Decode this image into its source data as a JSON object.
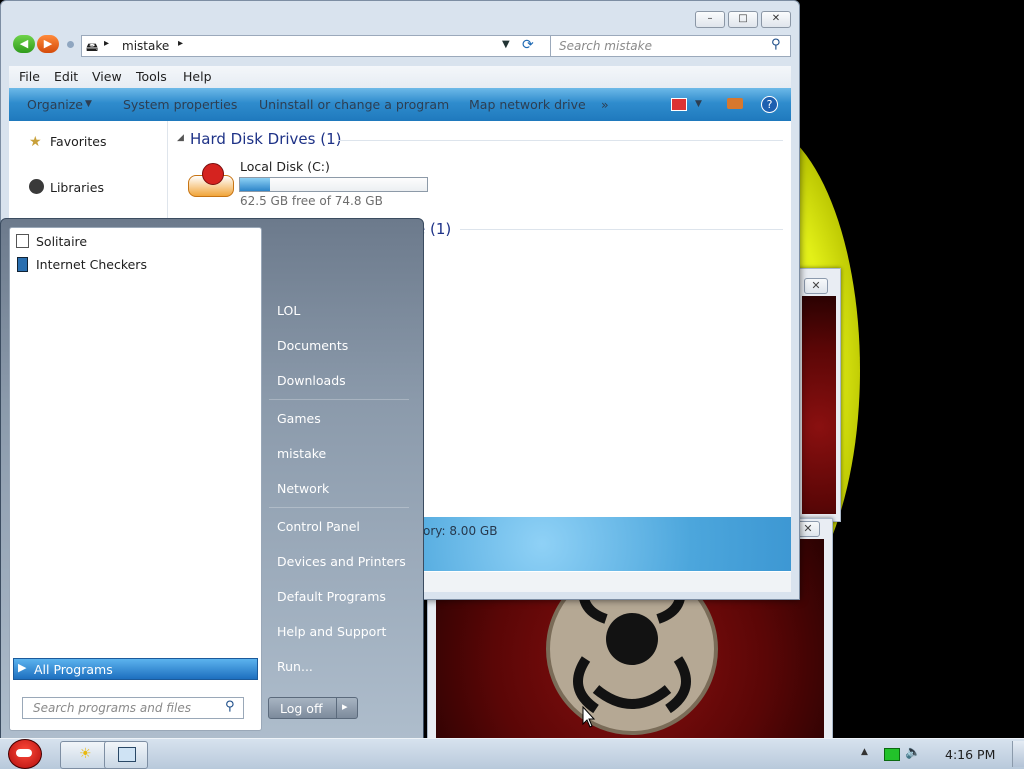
{
  "explorer": {
    "title_controls": {
      "minimize": "–",
      "maximize": "□",
      "close": "✕"
    },
    "address": {
      "path": "mistake"
    },
    "search": {
      "placeholder": "Search mistake"
    },
    "menu": [
      "File",
      "Edit",
      "View",
      "Tools",
      "Help"
    ],
    "commands": {
      "organize": "Organize",
      "system_properties": "System properties",
      "uninstall": "Uninstall or change a program",
      "map_drive": "Map network drive",
      "more": "»"
    },
    "nav": {
      "favorites": "Favorites",
      "libraries": "Libraries"
    },
    "group1": {
      "title": "Hard Disk Drives (1)",
      "drive": {
        "name": "Local Disk (C:)",
        "free": "62.5 GB free of 74.8 GB",
        "used_fraction": 0.16
      }
    },
    "group2": {
      "title_visible": "e (1)"
    },
    "details": {
      "memory_text": "ory: 8.00 GB"
    }
  },
  "startmenu": {
    "programs": [
      "Solitaire",
      "Internet Checkers"
    ],
    "all_programs": "All Programs",
    "search_placeholder": "Search programs and files",
    "right": [
      "LOL",
      "Documents",
      "Downloads",
      "Games",
      "mistake",
      "Network",
      "Control Panel",
      "Devices and Printers",
      "Default Programs",
      "Help and Support",
      "Run..."
    ],
    "logoff": "Log off",
    "logoff_arrow": "▸"
  },
  "bgwindows": {
    "close": "✕"
  },
  "taskbar": {
    "time": "4:16 PM"
  },
  "colors": {
    "accent": "#2f8ccd",
    "group_header": "#1e3287",
    "drive_bar": "#3a8fd0"
  }
}
